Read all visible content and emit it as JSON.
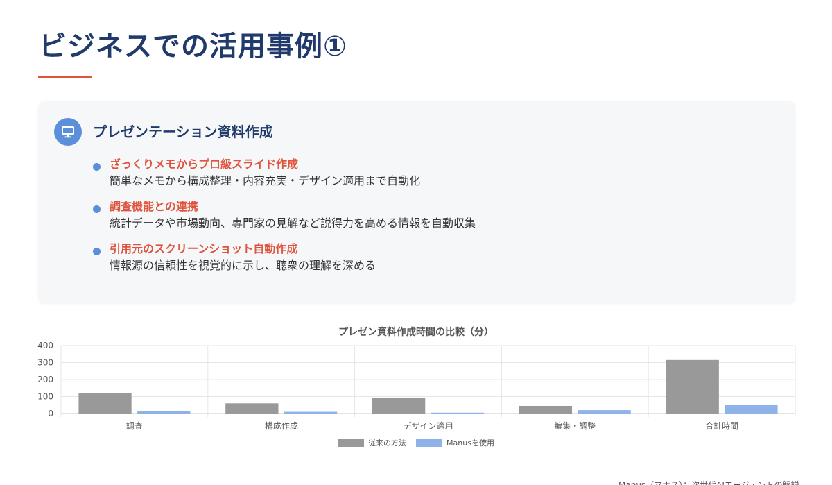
{
  "page": {
    "title": "ビジネスでの活用事例①"
  },
  "card": {
    "icon": "monitor-icon",
    "heading": "プレゼンテーション資料作成",
    "items": [
      {
        "head": "ざっくりメモからプロ級スライド作成",
        "desc": "簡単なメモから構成整理・内容充実・デザイン適用まで自動化"
      },
      {
        "head": "調査機能との連携",
        "desc": "統計データや市場動向、専門家の見解など説得力を高める情報を自動収集"
      },
      {
        "head": "引用元のスクリーンショット自動作成",
        "desc": "情報源の信頼性を視覚的に示し、聴衆の理解を深める"
      }
    ]
  },
  "colors": {
    "title": "#1f3a6b",
    "accent": "#e0533d",
    "icon_bg": "#5b8fd9",
    "series_traditional": "#999999",
    "series_manus": "#8fb3e8"
  },
  "chart_data": {
    "type": "bar",
    "title": "プレゼン資料作成時間の比較（分）",
    "categories": [
      "調査",
      "構成作成",
      "デザイン適用",
      "編集・調整",
      "合計時間"
    ],
    "series": [
      {
        "name": "従来の方法",
        "values": [
          120,
          60,
          90,
          45,
          315
        ],
        "color": "#999999"
      },
      {
        "name": "Manusを使用",
        "values": [
          15,
          10,
          5,
          20,
          50
        ],
        "color": "#8fb3e8"
      }
    ],
    "ylim": [
      0,
      400
    ],
    "yticks": [
      0,
      100,
      200,
      300,
      400
    ],
    "grid": true,
    "legend_position": "bottom"
  },
  "footer": {
    "note": "Manus（マナス）：次世代AIエージェントの解説"
  }
}
